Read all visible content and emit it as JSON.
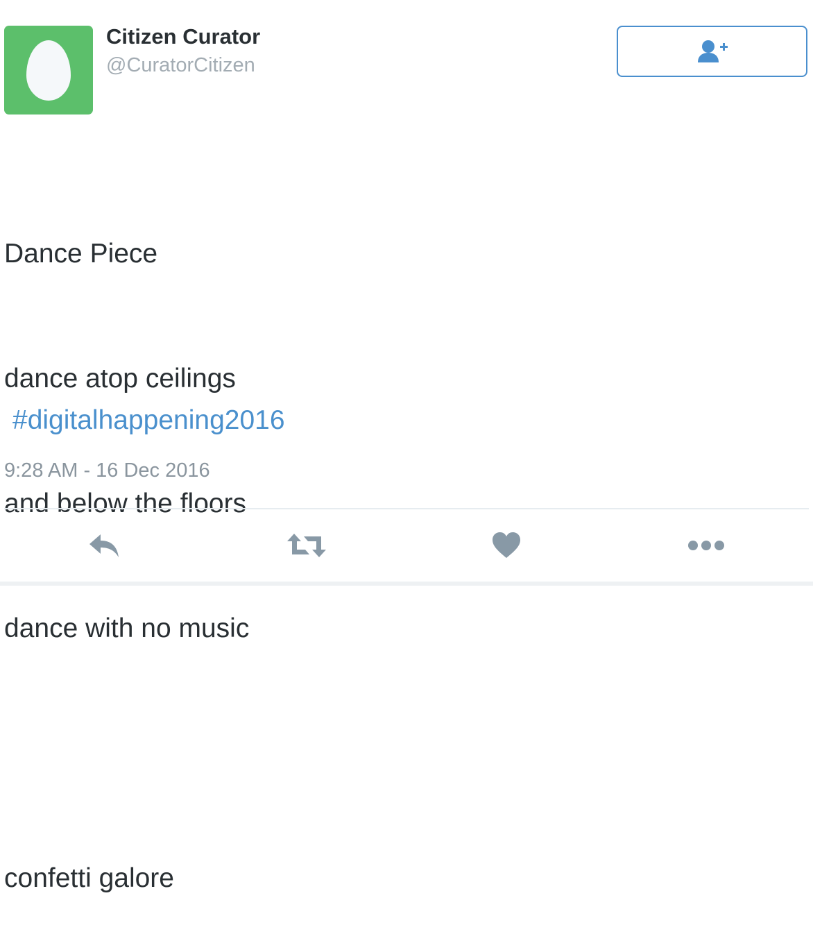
{
  "user": {
    "display_name": "Citizen Curator",
    "handle": "@CuratorCitizen",
    "avatar_icon": "default-egg-avatar"
  },
  "follow_button": {
    "icon": "add-user-icon",
    "border_color": "#4a8fce"
  },
  "tweet": {
    "lines": [
      "Dance Piece",
      "dance atop ceilings",
      "and below the floors",
      "dance with no music",
      "",
      "confetti galore"
    ],
    "hashtag": "#digitalhappening2016",
    "timestamp": "9:28 AM - 16 Dec 2016"
  },
  "actions": [
    {
      "icon": "reply-icon"
    },
    {
      "icon": "retweet-icon"
    },
    {
      "icon": "like-heart-icon"
    },
    {
      "icon": "more-options-icon"
    }
  ],
  "colors": {
    "avatar_bg": "#5cbf6b",
    "link": "#4a90cd",
    "text": "#292f33",
    "muted": "#a3acb3",
    "action_icon": "#8899a6"
  }
}
